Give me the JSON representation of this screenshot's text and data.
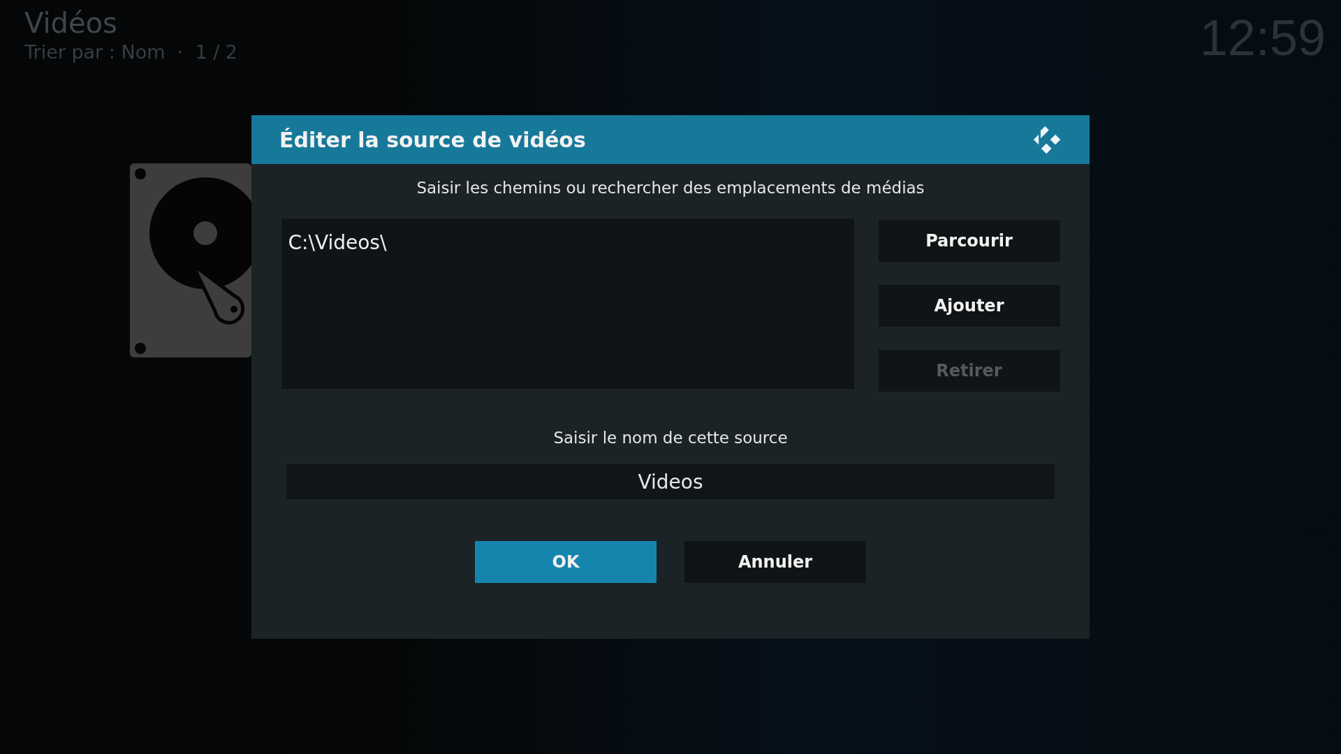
{
  "header": {
    "title": "Vidéos",
    "subtitle": "Trier par : Nom  ·  1 / 2",
    "clock": "12:59"
  },
  "dialog": {
    "title": "Éditer la source de vidéos",
    "paths_prompt": "Saisir les chemins ou rechercher des emplacements de médias",
    "paths": [
      "C:\\Videos\\"
    ],
    "side_buttons": [
      {
        "label": "Parcourir",
        "disabled": false
      },
      {
        "label": "Ajouter",
        "disabled": false
      },
      {
        "label": "Retirer",
        "disabled": true
      }
    ],
    "name_prompt": "Saisir le nom de cette source",
    "name_value": "Videos",
    "buttons": [
      {
        "label": "OK",
        "selected": true
      },
      {
        "label": "Annuler",
        "selected": false
      }
    ]
  }
}
